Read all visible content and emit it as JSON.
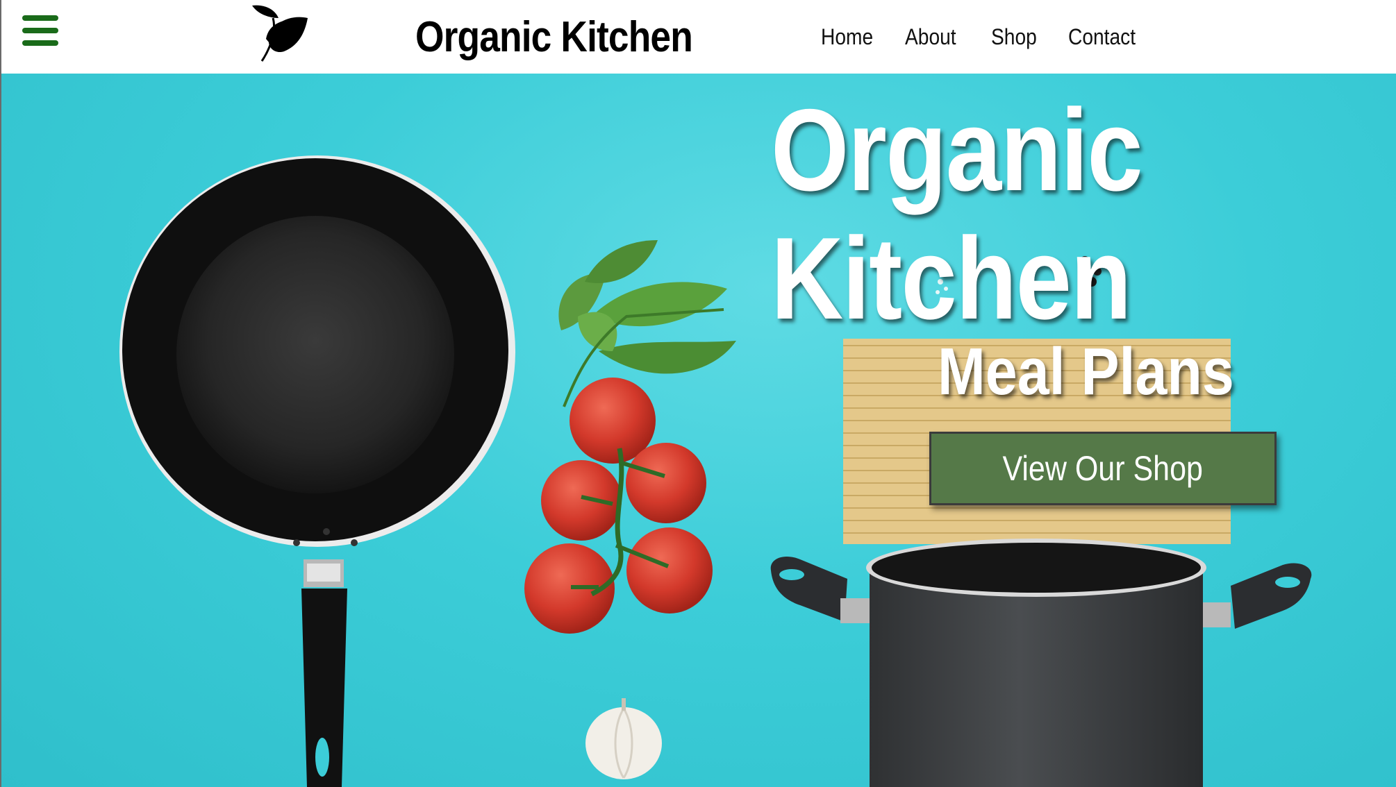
{
  "header": {
    "brand": "Organic Kitchen",
    "menu_icon": "hamburger-menu-icon",
    "logo_icon": "leaf-logo-icon",
    "nav": [
      {
        "label": "Home"
      },
      {
        "label": "About"
      },
      {
        "label": "Shop"
      },
      {
        "label": "Contact"
      }
    ]
  },
  "hero": {
    "title_line1": "Organic",
    "title_line2": "Kitchen",
    "subtitle": "Meal Plans",
    "cta_label": "View Our Shop"
  },
  "colors": {
    "hero_background": "#3ccdd8",
    "cta_background": "#557948",
    "menu_icon": "#1a6b1a",
    "text_dark": "#000000",
    "text_light": "#ffffff"
  }
}
